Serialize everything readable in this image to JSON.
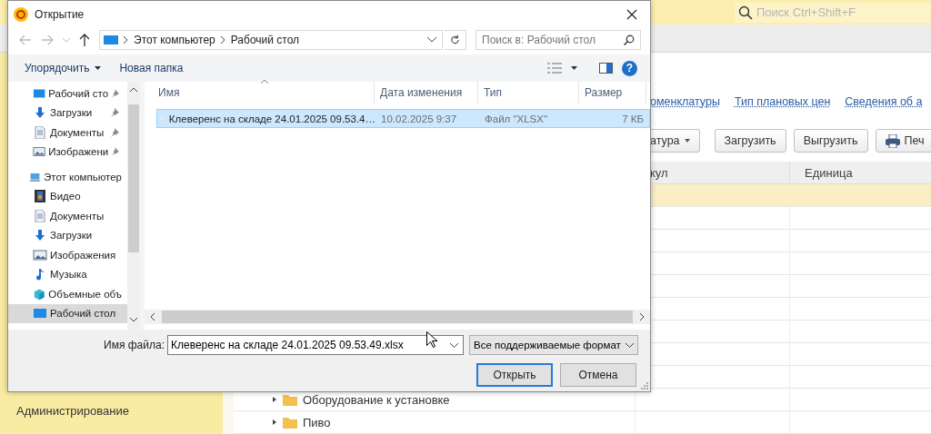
{
  "app": {
    "search": {
      "placeholder": "Поиск Ctrl+Shift+F"
    },
    "sidebar": {
      "items": [
        {
          "label": "Администрирование"
        }
      ]
    },
    "links": [
      "оменклатуры",
      "Тип плановых цен",
      "Сведения об а"
    ],
    "toolbar": [
      {
        "label": "атура",
        "kind": "dropdown"
      },
      {
        "label": "Загрузить",
        "kind": "plain"
      },
      {
        "label": "Выгрузить",
        "kind": "plain"
      },
      {
        "label": "Печ",
        "kind": "print"
      }
    ],
    "table": {
      "columns": [
        "кул",
        "Единица"
      ],
      "rows": [
        {
          "selected": true
        },
        {
          "selected": false
        },
        {
          "selected": false
        },
        {
          "selected": false
        },
        {
          "selected": false
        },
        {
          "selected": false
        },
        {
          "selected": false
        },
        {
          "selected": false
        },
        {
          "selected": false
        },
        {
          "label": "Оборудование к установке",
          "expanded": false,
          "selected": false
        },
        {
          "label": "Пиво",
          "expanded": false,
          "selected": false
        }
      ]
    }
  },
  "dialog": {
    "title": "Открытие",
    "path": [
      "Этот компьютер",
      "Рабочий стол"
    ],
    "search": {
      "placeholder": "Поиск в: Рабочий стол"
    },
    "toolbar": [
      {
        "label": "Упорядочить",
        "kind": "menu"
      },
      {
        "label": "Новая папка",
        "kind": "plain"
      }
    ],
    "help": "?",
    "nav": [
      {
        "label": "Рабочий сто",
        "kind": "desktop",
        "pinned": true,
        "selected": false
      },
      {
        "label": "Загрузки",
        "kind": "download",
        "pinned": true,
        "selected": false
      },
      {
        "label": "Документы",
        "kind": "document",
        "pinned": true,
        "selected": false
      },
      {
        "label": "Изображени",
        "kind": "picture",
        "pinned": true,
        "selected": false
      },
      {
        "label": "Этот компьютер",
        "kind": "computer",
        "pinned": false,
        "selected": false,
        "children": [
          {
            "label": "Видео",
            "kind": "video",
            "pinned": false,
            "selected": false
          },
          {
            "label": "Документы",
            "kind": "document",
            "pinned": false,
            "selected": false
          },
          {
            "label": "Загрузки",
            "kind": "download",
            "pinned": false,
            "selected": false
          },
          {
            "label": "Изображения",
            "kind": "picture",
            "pinned": false,
            "selected": false
          },
          {
            "label": "Музыка",
            "kind": "music",
            "pinned": false,
            "selected": false
          },
          {
            "label": "Объемные объ",
            "kind": "objects",
            "pinned": false,
            "selected": false
          },
          {
            "label": "Рабочий стол",
            "kind": "desktop",
            "pinned": false,
            "selected": true
          }
        ]
      }
    ],
    "files": {
      "columns": [
        "Имя",
        "Дата изменения",
        "Тип",
        "Размер"
      ],
      "rows": [
        {
          "name": "Клеверенс на складе 24.01.2025 09.53.4…",
          "date": "10.02.2025 9:37",
          "type": "Файл \"XLSX\"",
          "size": "7 КБ",
          "selected": true
        }
      ]
    },
    "file_name": {
      "label": "Имя файла:",
      "value": "Клеверенс на складе 24.01.2025 09.53.49.xlsx"
    },
    "file_type": "Все поддерживаемые формат",
    "buttons": [
      {
        "label": "Открыть",
        "default": true
      },
      {
        "label": "Отмена",
        "default": false
      }
    ]
  }
}
